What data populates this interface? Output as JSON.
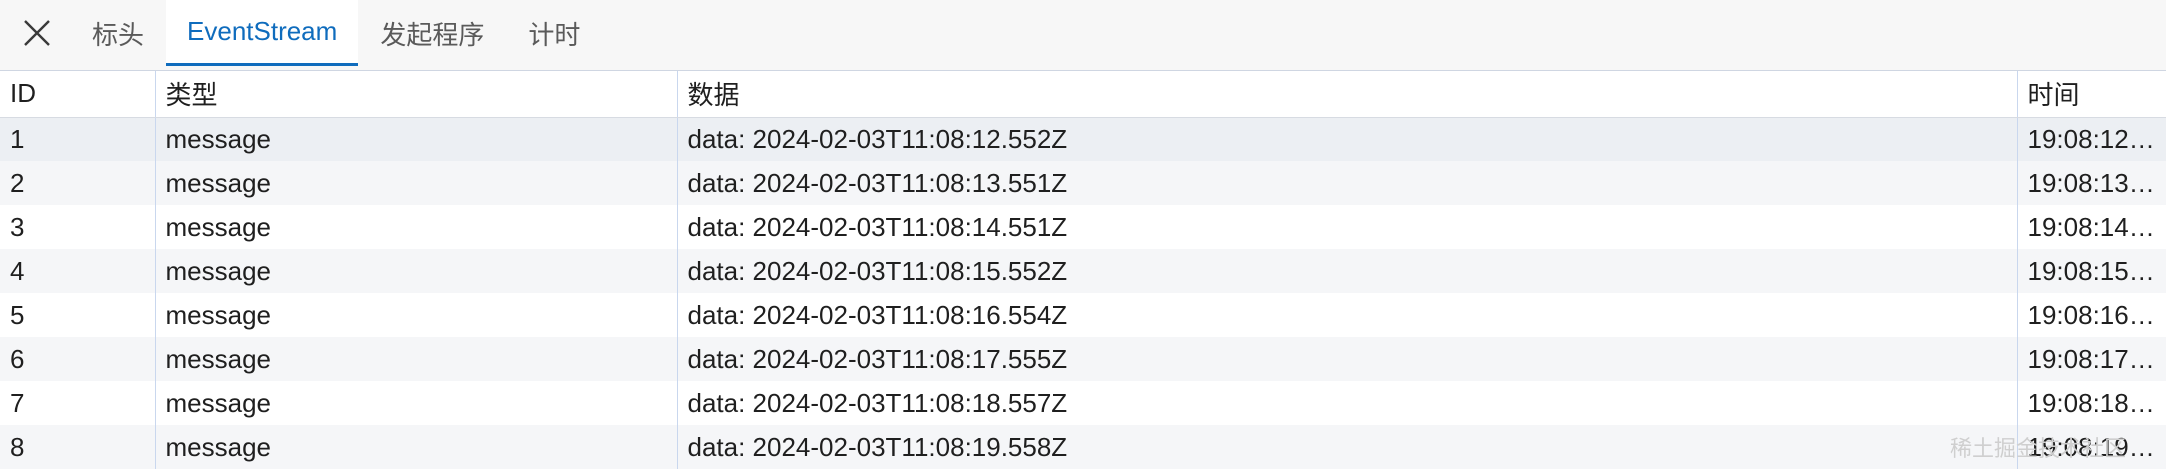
{
  "tabs": [
    {
      "label": "标头"
    },
    {
      "label": "EventStream"
    },
    {
      "label": "发起程序"
    },
    {
      "label": "计时"
    }
  ],
  "table": {
    "headers": [
      "ID",
      "类型",
      "数据",
      "时间"
    ],
    "rows": [
      {
        "id": "1",
        "type": "message",
        "data": "data: 2024-02-03T11:08:12.552Z",
        "time": "19:08:12.…"
      },
      {
        "id": "2",
        "type": "message",
        "data": "data: 2024-02-03T11:08:13.551Z",
        "time": "19:08:13.…"
      },
      {
        "id": "3",
        "type": "message",
        "data": "data: 2024-02-03T11:08:14.551Z",
        "time": "19:08:14.…"
      },
      {
        "id": "4",
        "type": "message",
        "data": "data: 2024-02-03T11:08:15.552Z",
        "time": "19:08:15.…"
      },
      {
        "id": "5",
        "type": "message",
        "data": "data: 2024-02-03T11:08:16.554Z",
        "time": "19:08:16.…"
      },
      {
        "id": "6",
        "type": "message",
        "data": "data: 2024-02-03T11:08:17.555Z",
        "time": "19:08:17.…"
      },
      {
        "id": "7",
        "type": "message",
        "data": "data: 2024-02-03T11:08:18.557Z",
        "time": "19:08:18.…"
      },
      {
        "id": "8",
        "type": "message",
        "data": "data: 2024-02-03T11:08:19.558Z",
        "time": "19:08:19.…"
      }
    ]
  },
  "watermark": "稀土掘金技术社区",
  "colors": {
    "accent": "#0f6cbd",
    "grid_line": "#c9d7ee"
  },
  "icons": {
    "close": "close-icon"
  }
}
